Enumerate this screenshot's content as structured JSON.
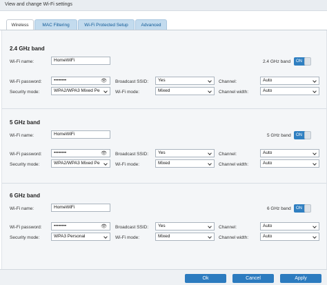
{
  "header": {
    "title": "View and change Wi-Fi settings"
  },
  "tabs": [
    {
      "label": "Wireless",
      "active": true
    },
    {
      "label": "MAC Filtering",
      "active": false
    },
    {
      "label": "Wi-Fi Protected Setup",
      "active": false
    },
    {
      "label": "Advanced",
      "active": false
    }
  ],
  "labels": {
    "wifi_name": "Wi-Fi name:",
    "wifi_password": "Wi-Fi password:",
    "security_mode": "Security mode:",
    "broadcast_ssid": "Broadcast SSID:",
    "wifi_mode": "Wi-Fi mode:",
    "channel": "Channel:",
    "channel_width": "Channel width:"
  },
  "bands": [
    {
      "title": "2.4 GHz band",
      "toggle_label": "2.4 GHz band",
      "toggle_state": "ON",
      "wifi_name": "HomeWiFi",
      "password": "••••••••",
      "security_mode": "WPA2/WPA3 Mixed Pe",
      "broadcast_ssid": "Yes",
      "wifi_mode": "Mixed",
      "channel": "Auto",
      "channel_width": "Auto"
    },
    {
      "title": "5 GHz band",
      "toggle_label": "5 GHz band",
      "toggle_state": "ON",
      "wifi_name": "HomeWiFi",
      "password": "••••••••",
      "security_mode": "WPA2/WPA3 Mixed Pe",
      "broadcast_ssid": "Yes",
      "wifi_mode": "Mixed",
      "channel": "Auto",
      "channel_width": "Auto"
    },
    {
      "title": "6 GHz band",
      "toggle_label": "6 GHz band",
      "toggle_state": "ON",
      "wifi_name": "HomeWiFi",
      "password": "••••••••",
      "security_mode": "WPA3 Personal",
      "broadcast_ssid": "Yes",
      "wifi_mode": "Mixed",
      "channel": "Auto",
      "channel_width": "Auto"
    }
  ],
  "buttons": {
    "ok": "Ok",
    "cancel": "Cancel",
    "apply": "Apply"
  },
  "colors": {
    "accent": "#2c7bbf",
    "tab_inactive": "#c3dbee",
    "panel_bg": "#f4f6f8"
  },
  "icons": {
    "password_reveal": "eye-icon"
  }
}
